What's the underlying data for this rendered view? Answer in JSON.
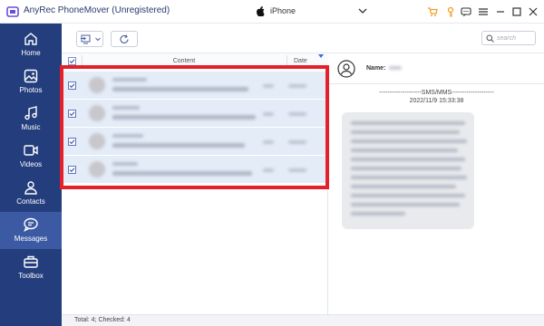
{
  "app": {
    "title": "AnyRec PhoneMover (Unregistered)"
  },
  "device": {
    "name": "iPhone"
  },
  "sidebar": {
    "items": [
      {
        "label": "Home",
        "icon": "home-icon"
      },
      {
        "label": "Photos",
        "icon": "photos-icon"
      },
      {
        "label": "Music",
        "icon": "music-icon"
      },
      {
        "label": "Videos",
        "icon": "videos-icon"
      },
      {
        "label": "Contacts",
        "icon": "contacts-icon"
      },
      {
        "label": "Messages",
        "icon": "messages-icon",
        "active": true
      },
      {
        "label": "Toolbox",
        "icon": "toolbox-icon"
      }
    ]
  },
  "toolbar": {
    "search_placeholder": "search"
  },
  "list": {
    "columns": {
      "content": "Content",
      "date": "Date"
    },
    "rows": [
      {
        "checked": true
      },
      {
        "checked": true
      },
      {
        "checked": true
      },
      {
        "checked": true
      }
    ]
  },
  "detail": {
    "name_label": "Name:",
    "type_label": "--------------------SMS/MMS--------------------",
    "timestamp": "2022/11/9 15:33:38"
  },
  "status": {
    "summary": "Total: 4; Checked: 4"
  },
  "colors": {
    "sidebar": "#243d7d",
    "sidebar_active": "#3c5aa3",
    "row_selected": "#e4ecf8",
    "highlight": "#e5202a",
    "accent_orange": "#f39a1e"
  }
}
